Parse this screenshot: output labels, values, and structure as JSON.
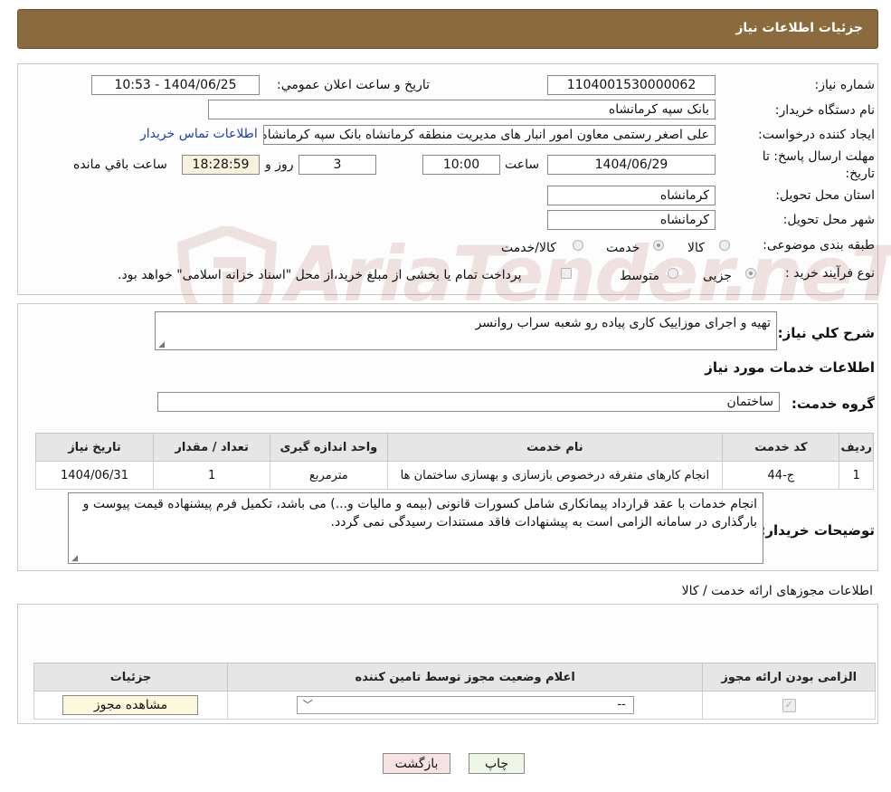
{
  "header": {
    "title": "جزئیات اطلاعات نیاز"
  },
  "form": {
    "need_number_label": "شماره نیاز:",
    "need_number_value": "1104001530000062",
    "announce_label": "تاریخ و ساعت اعلان عمومي:",
    "announce_value": "1404/06/25 - 10:53",
    "buyer_org_label": "نام دستگاه خریدار:",
    "buyer_org_value": "بانک سپه کرمانشاه",
    "creator_label": "ایجاد کننده درخواست:",
    "creator_value": "علی اصغر رستمی معاون امور انبار های مدیریت منطقه کرمانشاه بانک سپه کرمانشاه",
    "contact_link": "اطلاعات تماس خریدار",
    "deadline_label_line1": "مهلت ارسال پاسخ: تا",
    "deadline_label_line2": "تاریخ:",
    "deadline_date": "1404/06/29",
    "time_label": "ساعت",
    "deadline_time": "10:00",
    "days_value": "3",
    "days_label": "روز و",
    "remaining_time": "18:28:59",
    "remaining_label": "ساعت باقي مانده",
    "province_label": "استان محل تحویل:",
    "province_value": "کرمانشاه",
    "city_label": "شهر محل تحویل:",
    "city_value": "کرمانشاه",
    "category_label": "طبقه بندی موضوعی:",
    "category_options": [
      "کالا",
      "خدمت",
      "کالا/خدمت"
    ],
    "category_selected": "خدمت",
    "process_label": "نوع فرآیند خرید :",
    "process_options": [
      "جزیی",
      "متوسط"
    ],
    "payment_note": "پرداخت تمام یا بخشی از مبلغ خرید،از محل \"اسناد خزانه اسلامی\" خواهد بود."
  },
  "summary": {
    "title_label": "شرح کلي نياز:",
    "title_value": "تهیه و اجرای موزاییک کاری پیاده رو شعبه سراب روانسر",
    "services_heading": "اطلاعات خدمات مورد نیاز",
    "service_group_label": "گروه خدمت:",
    "service_group_value": "ساختمان",
    "table": {
      "headers": [
        "ردیف",
        "کد خدمت",
        "نام خدمت",
        "واحد اندازه گیری",
        "تعداد / مقدار",
        "تاریخ نیاز"
      ],
      "rows": [
        [
          "1",
          "ج-44",
          "انجام کارهای متفرقه درخصوص بازسازی و بهسازی ساختمان ها",
          "مترمربع",
          "1",
          "1404/06/31"
        ]
      ]
    },
    "buyer_notes_label": "توضیحات خریدار:",
    "buyer_notes_value": "انجام خدمات با عقد قرارداد پیمانکاری شامل کسورات قانونی (بیمه و مالیات و...) می باشد، تکمیل فرم پیشنهاده قیمت پیوست  و بارگذاری در سامانه الزامی است به پیشنهادات فاقد مستندات رسیدگی نمی گردد."
  },
  "permits": {
    "heading": "اطلاعات مجوزهای ارائه خدمت / کالا",
    "headers": [
      "الزامی بودن ارائه مجوز",
      "اعلام وضعیت مجوز توسط تامین کننده",
      "جزئیات"
    ],
    "select_value": "--",
    "view_button": "مشاهده مجوز"
  },
  "buttons": {
    "print": "چاپ",
    "back": "بازگشت"
  },
  "colors": {
    "header_bg": "#8b6a3e",
    "link": "#1b3fae",
    "back_button_bg": "#f7e3e3"
  }
}
